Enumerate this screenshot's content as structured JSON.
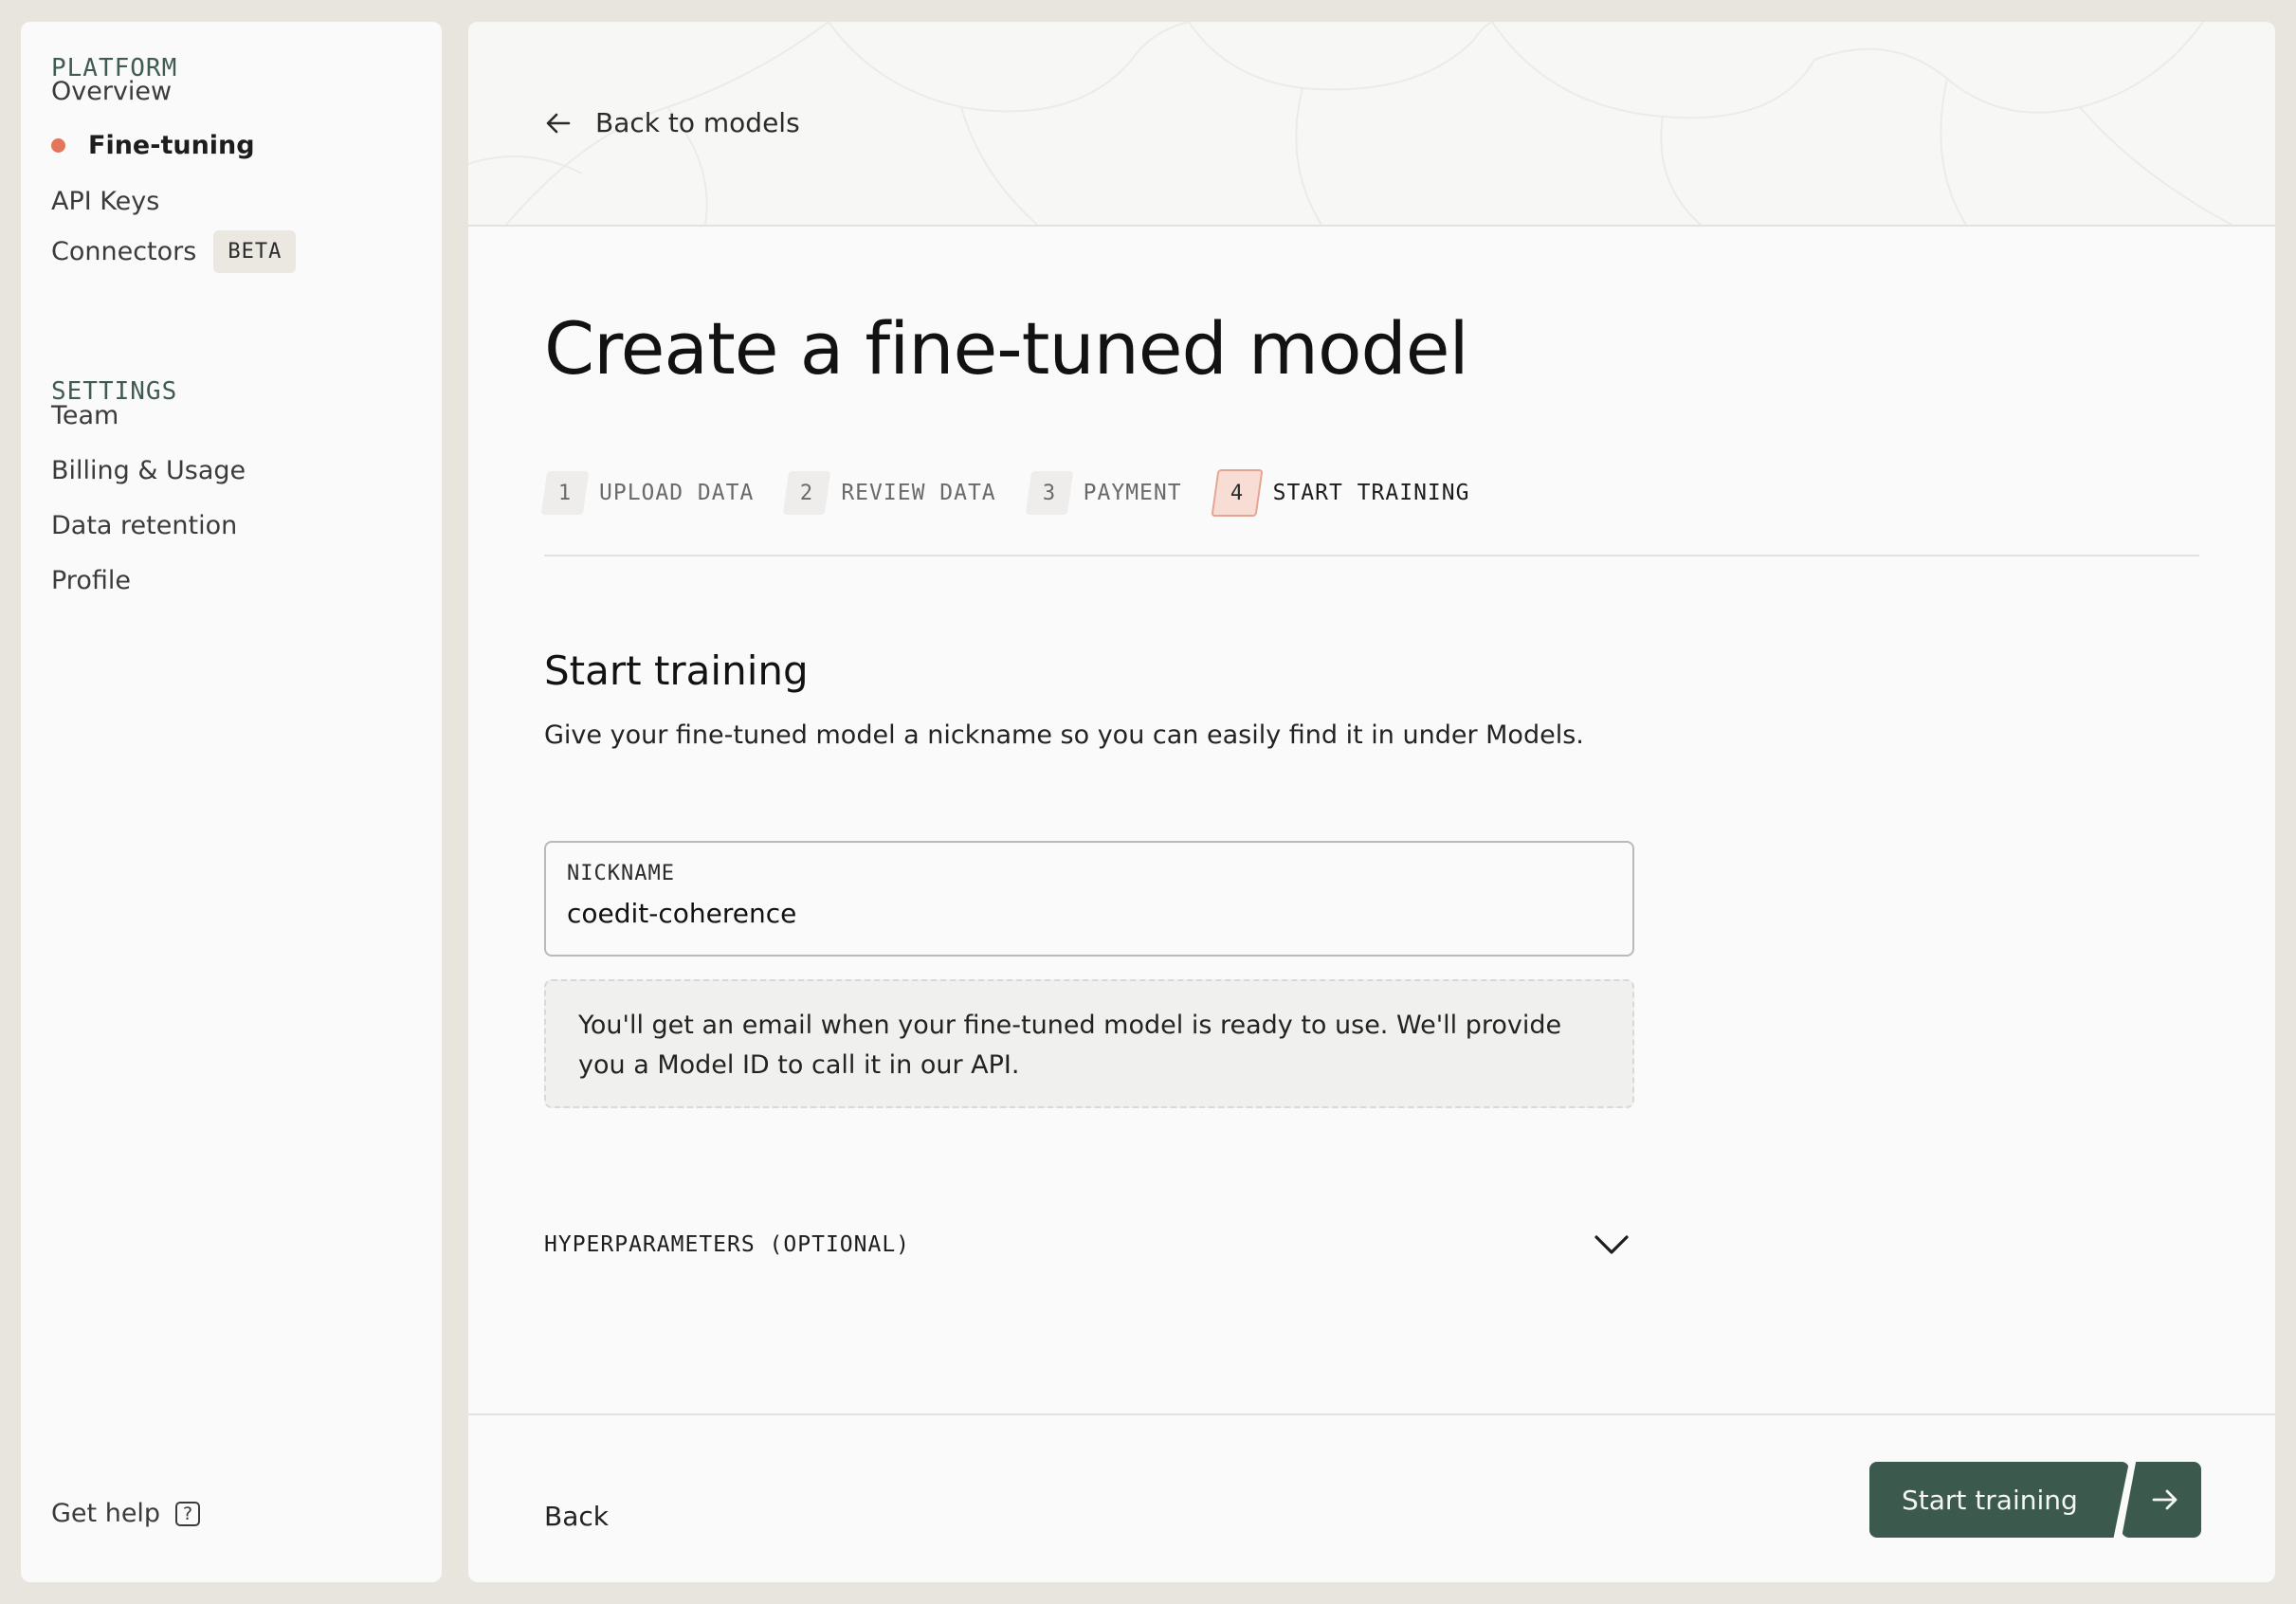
{
  "sidebar": {
    "platform_label": "PLATFORM",
    "platform_items": [
      {
        "label": "Overview"
      },
      {
        "label": "Fine-tuning",
        "active": true
      },
      {
        "label": "API Keys"
      },
      {
        "label": "Connectors",
        "badge": "BETA"
      }
    ],
    "settings_label": "SETTINGS",
    "settings_items": [
      {
        "label": "Team"
      },
      {
        "label": "Billing & Usage"
      },
      {
        "label": "Data retention"
      },
      {
        "label": "Profile"
      }
    ],
    "help_label": "Get help",
    "help_icon_glyph": "?"
  },
  "header": {
    "back_label": "Back to models"
  },
  "main": {
    "title": "Create a fine-tuned model",
    "steps": [
      {
        "number": "1",
        "label": "UPLOAD DATA"
      },
      {
        "number": "2",
        "label": "REVIEW DATA"
      },
      {
        "number": "3",
        "label": "PAYMENT"
      },
      {
        "number": "4",
        "label": "START TRAINING",
        "current": true
      }
    ],
    "section_title": "Start training",
    "section_description": "Give your fine-tuned model a nickname so you can easily find it in under Models.",
    "nickname": {
      "label": "NICKNAME",
      "value": "coedit-coherence"
    },
    "info_text": "You'll get an email when your fine-tuned model is ready to use. We'll provide you a Model ID to call it in our API.",
    "hyperparameters_label": "HYPERPARAMETERS (OPTIONAL)"
  },
  "footer": {
    "back_label": "Back",
    "primary_label": "Start training"
  },
  "colors": {
    "accent_dot": "#e2765c",
    "primary_button": "#3b5a4d",
    "current_step_bg": "#f7ddd4"
  },
  "icons": {
    "back": "arrow-left-icon",
    "expand": "chevron-down-icon",
    "submit": "arrow-right-icon",
    "help": "question-square-icon"
  }
}
